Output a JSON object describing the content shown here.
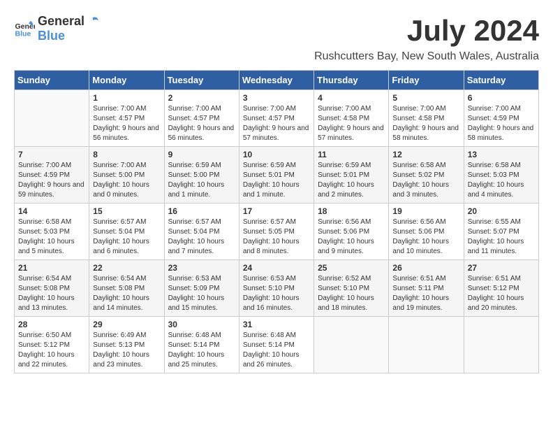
{
  "header": {
    "logo_general": "General",
    "logo_blue": "Blue",
    "month_year": "July 2024",
    "location": "Rushcutters Bay, New South Wales, Australia"
  },
  "days_of_week": [
    "Sunday",
    "Monday",
    "Tuesday",
    "Wednesday",
    "Thursday",
    "Friday",
    "Saturday"
  ],
  "weeks": [
    [
      {
        "day": "",
        "sunrise": "",
        "sunset": "",
        "daylight": ""
      },
      {
        "day": "1",
        "sunrise": "Sunrise: 7:00 AM",
        "sunset": "Sunset: 4:57 PM",
        "daylight": "Daylight: 9 hours and 56 minutes."
      },
      {
        "day": "2",
        "sunrise": "Sunrise: 7:00 AM",
        "sunset": "Sunset: 4:57 PM",
        "daylight": "Daylight: 9 hours and 56 minutes."
      },
      {
        "day": "3",
        "sunrise": "Sunrise: 7:00 AM",
        "sunset": "Sunset: 4:57 PM",
        "daylight": "Daylight: 9 hours and 57 minutes."
      },
      {
        "day": "4",
        "sunrise": "Sunrise: 7:00 AM",
        "sunset": "Sunset: 4:58 PM",
        "daylight": "Daylight: 9 hours and 57 minutes."
      },
      {
        "day": "5",
        "sunrise": "Sunrise: 7:00 AM",
        "sunset": "Sunset: 4:58 PM",
        "daylight": "Daylight: 9 hours and 58 minutes."
      },
      {
        "day": "6",
        "sunrise": "Sunrise: 7:00 AM",
        "sunset": "Sunset: 4:59 PM",
        "daylight": "Daylight: 9 hours and 58 minutes."
      }
    ],
    [
      {
        "day": "7",
        "sunrise": "Sunrise: 7:00 AM",
        "sunset": "Sunset: 4:59 PM",
        "daylight": "Daylight: 9 hours and 59 minutes."
      },
      {
        "day": "8",
        "sunrise": "Sunrise: 7:00 AM",
        "sunset": "Sunset: 5:00 PM",
        "daylight": "Daylight: 10 hours and 0 minutes."
      },
      {
        "day": "9",
        "sunrise": "Sunrise: 6:59 AM",
        "sunset": "Sunset: 5:00 PM",
        "daylight": "Daylight: 10 hours and 1 minute."
      },
      {
        "day": "10",
        "sunrise": "Sunrise: 6:59 AM",
        "sunset": "Sunset: 5:01 PM",
        "daylight": "Daylight: 10 hours and 1 minute."
      },
      {
        "day": "11",
        "sunrise": "Sunrise: 6:59 AM",
        "sunset": "Sunset: 5:01 PM",
        "daylight": "Daylight: 10 hours and 2 minutes."
      },
      {
        "day": "12",
        "sunrise": "Sunrise: 6:58 AM",
        "sunset": "Sunset: 5:02 PM",
        "daylight": "Daylight: 10 hours and 3 minutes."
      },
      {
        "day": "13",
        "sunrise": "Sunrise: 6:58 AM",
        "sunset": "Sunset: 5:03 PM",
        "daylight": "Daylight: 10 hours and 4 minutes."
      }
    ],
    [
      {
        "day": "14",
        "sunrise": "Sunrise: 6:58 AM",
        "sunset": "Sunset: 5:03 PM",
        "daylight": "Daylight: 10 hours and 5 minutes."
      },
      {
        "day": "15",
        "sunrise": "Sunrise: 6:57 AM",
        "sunset": "Sunset: 5:04 PM",
        "daylight": "Daylight: 10 hours and 6 minutes."
      },
      {
        "day": "16",
        "sunrise": "Sunrise: 6:57 AM",
        "sunset": "Sunset: 5:04 PM",
        "daylight": "Daylight: 10 hours and 7 minutes."
      },
      {
        "day": "17",
        "sunrise": "Sunrise: 6:57 AM",
        "sunset": "Sunset: 5:05 PM",
        "daylight": "Daylight: 10 hours and 8 minutes."
      },
      {
        "day": "18",
        "sunrise": "Sunrise: 6:56 AM",
        "sunset": "Sunset: 5:06 PM",
        "daylight": "Daylight: 10 hours and 9 minutes."
      },
      {
        "day": "19",
        "sunrise": "Sunrise: 6:56 AM",
        "sunset": "Sunset: 5:06 PM",
        "daylight": "Daylight: 10 hours and 10 minutes."
      },
      {
        "day": "20",
        "sunrise": "Sunrise: 6:55 AM",
        "sunset": "Sunset: 5:07 PM",
        "daylight": "Daylight: 10 hours and 11 minutes."
      }
    ],
    [
      {
        "day": "21",
        "sunrise": "Sunrise: 6:54 AM",
        "sunset": "Sunset: 5:08 PM",
        "daylight": "Daylight: 10 hours and 13 minutes."
      },
      {
        "day": "22",
        "sunrise": "Sunrise: 6:54 AM",
        "sunset": "Sunset: 5:08 PM",
        "daylight": "Daylight: 10 hours and 14 minutes."
      },
      {
        "day": "23",
        "sunrise": "Sunrise: 6:53 AM",
        "sunset": "Sunset: 5:09 PM",
        "daylight": "Daylight: 10 hours and 15 minutes."
      },
      {
        "day": "24",
        "sunrise": "Sunrise: 6:53 AM",
        "sunset": "Sunset: 5:10 PM",
        "daylight": "Daylight: 10 hours and 16 minutes."
      },
      {
        "day": "25",
        "sunrise": "Sunrise: 6:52 AM",
        "sunset": "Sunset: 5:10 PM",
        "daylight": "Daylight: 10 hours and 18 minutes."
      },
      {
        "day": "26",
        "sunrise": "Sunrise: 6:51 AM",
        "sunset": "Sunset: 5:11 PM",
        "daylight": "Daylight: 10 hours and 19 minutes."
      },
      {
        "day": "27",
        "sunrise": "Sunrise: 6:51 AM",
        "sunset": "Sunset: 5:12 PM",
        "daylight": "Daylight: 10 hours and 20 minutes."
      }
    ],
    [
      {
        "day": "28",
        "sunrise": "Sunrise: 6:50 AM",
        "sunset": "Sunset: 5:12 PM",
        "daylight": "Daylight: 10 hours and 22 minutes."
      },
      {
        "day": "29",
        "sunrise": "Sunrise: 6:49 AM",
        "sunset": "Sunset: 5:13 PM",
        "daylight": "Daylight: 10 hours and 23 minutes."
      },
      {
        "day": "30",
        "sunrise": "Sunrise: 6:48 AM",
        "sunset": "Sunset: 5:14 PM",
        "daylight": "Daylight: 10 hours and 25 minutes."
      },
      {
        "day": "31",
        "sunrise": "Sunrise: 6:48 AM",
        "sunset": "Sunset: 5:14 PM",
        "daylight": "Daylight: 10 hours and 26 minutes."
      },
      {
        "day": "",
        "sunrise": "",
        "sunset": "",
        "daylight": ""
      },
      {
        "day": "",
        "sunrise": "",
        "sunset": "",
        "daylight": ""
      },
      {
        "day": "",
        "sunrise": "",
        "sunset": "",
        "daylight": ""
      }
    ]
  ]
}
